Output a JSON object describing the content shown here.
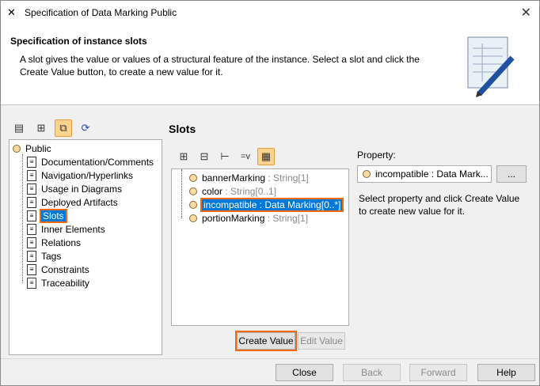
{
  "window": {
    "title": "Specification of Data Marking Public"
  },
  "header": {
    "title": "Specification of instance slots",
    "description": "A slot gives the value or values of a structural feature of the instance. Select a slot and click the Create Value button, to create a new value for it."
  },
  "tree": {
    "root": "Public",
    "items": [
      "Documentation/Comments",
      "Navigation/Hyperlinks",
      "Usage in Diagrams",
      "Deployed Artifacts",
      "Slots",
      "Inner Elements",
      "Relations",
      "Tags",
      "Constraints",
      "Traceability"
    ],
    "selected": "Slots"
  },
  "slots": {
    "title": "Slots",
    "items": [
      {
        "name": "bannerMarking",
        "type": " : String[1]"
      },
      {
        "name": "color",
        "type": " : String[0..1]"
      },
      {
        "name": "incompatible : Data Marking[0..*]",
        "type": ""
      },
      {
        "name": "portionMarking",
        "type": " : String[1]"
      }
    ],
    "create_value": "Create Value",
    "edit_value": "Edit Value",
    "filter_label": "=v"
  },
  "property": {
    "label": "Property:",
    "value": "incompatible : Data Mark...",
    "browse": "...",
    "hint": "Select property and click Create Value to create new value for it."
  },
  "footer": {
    "close": "Close",
    "back": "Back",
    "forward": "Forward",
    "help": "Help"
  }
}
